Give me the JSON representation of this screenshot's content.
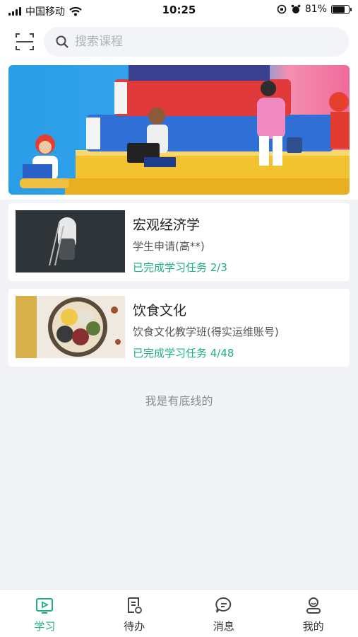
{
  "status_bar": {
    "carrier": "中国移动",
    "time": "10:25",
    "battery_percent": "81%",
    "battery_level": 0.81
  },
  "search": {
    "placeholder": "搜索课程"
  },
  "courses": [
    {
      "title": "宏观经济学",
      "subtitle": "学生申请(高**)",
      "progress": "已完成学习任务 2/3"
    },
    {
      "title": "饮食文化",
      "subtitle": "饮食文化教学班(得实运维账号)",
      "progress": "已完成学习任务 4/48"
    }
  ],
  "end_text": "我是有底线的",
  "tabs": [
    {
      "label": "学习",
      "icon": "play-screen-icon",
      "active": true
    },
    {
      "label": "待办",
      "icon": "todo-list-icon",
      "active": false
    },
    {
      "label": "消息",
      "icon": "chat-bubble-icon",
      "active": false
    },
    {
      "label": "我的",
      "icon": "profile-icon",
      "active": false
    }
  ],
  "colors": {
    "accent": "#1db07e",
    "background": "#f2f3f7"
  }
}
